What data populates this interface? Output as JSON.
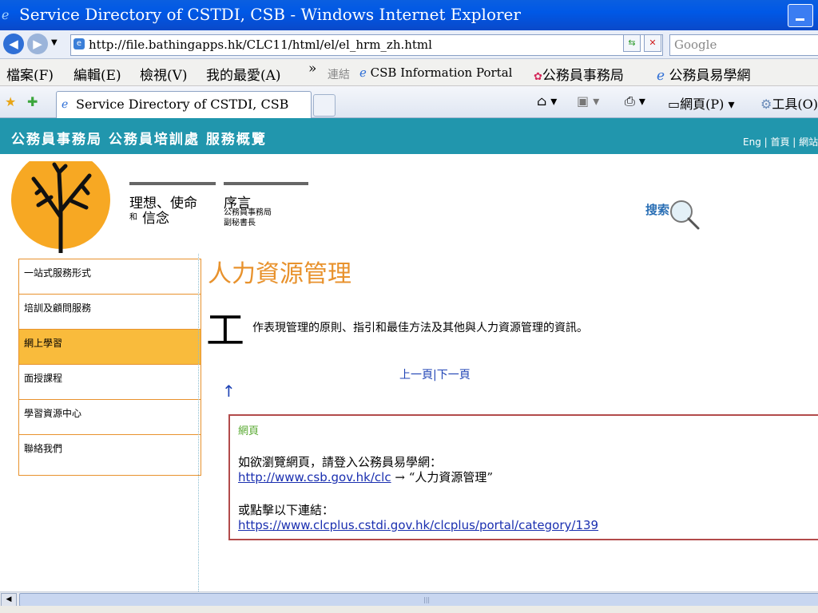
{
  "window": {
    "title": "Service Directory of CSTDI, CSB - Windows Internet Explorer"
  },
  "address_bar": {
    "url": "http://file.bathingapps.hk/CLC11/html/el/el_hrm_zh.html",
    "search_placeholder": "Google"
  },
  "menu": {
    "items": [
      "檔案(F)",
      "編輯(E)",
      "檢視(V)",
      "我的最愛(A)"
    ],
    "links_chevron": "»",
    "links_label": "連結",
    "links": [
      "CSB Information Portal",
      "公務員事務局",
      "公務員易學網"
    ]
  },
  "tabs": {
    "active_tab": "Service Directory of CSTDI, CSB",
    "tools": [
      "網頁(P)",
      "工具(O)"
    ]
  },
  "site": {
    "title": "公務員事務局 公務員培訓處 服務概覽",
    "top_links": "Eng | 首頁 | 網站"
  },
  "header_nav": {
    "vision": {
      "big": "理想、使命",
      "prefix": "和",
      "suffix": "信念"
    },
    "preface": {
      "big": "序言",
      "line1": "公務員事務局",
      "line2": "副秘書長"
    },
    "search_label": "搜索"
  },
  "sidebar": {
    "items": [
      {
        "label": "一站式服務形式",
        "active": false
      },
      {
        "label": "培訓及顧問服務",
        "active": false
      },
      {
        "label": "網上學習",
        "active": true
      },
      {
        "label": "面授課程",
        "active": false
      },
      {
        "label": "學習資源中心",
        "active": false
      },
      {
        "label": "聯絡我們",
        "active": false
      }
    ]
  },
  "content": {
    "title": "人力資源管理",
    "dropcap": "工",
    "intro": "作表現管理的原則、指引和最佳方法及其他與人力資源管理的資訊。",
    "pager_prev": "上一頁",
    "pager_sep": "|",
    "pager_next": "下一頁",
    "up_arrow": "↑",
    "box": {
      "heading": "網頁",
      "line1": "如欲瀏覽網頁，請登入公務員易學網：",
      "link1": "http://www.csb.gov.hk/clc",
      "link1_suffix": " → “人力資源管理”",
      "line3": "或點擊以下連結：",
      "link2": "https://www.clcplus.cstdi.gov.hk/clcplus/portal/category/139"
    }
  },
  "colors": {
    "header_bg": "#2196ad",
    "accent_orange": "#e8922d",
    "active_item": "#f9bb3c",
    "box_border": "#b24b4b",
    "tree_sun": "#f7a823"
  }
}
